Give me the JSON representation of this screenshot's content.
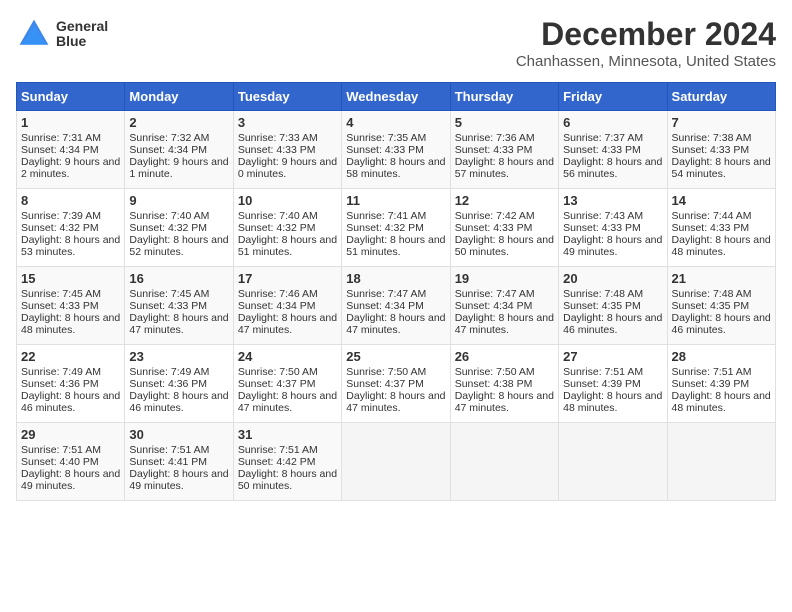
{
  "header": {
    "logo_line1": "General",
    "logo_line2": "Blue",
    "title": "December 2024",
    "subtitle": "Chanhassen, Minnesota, United States"
  },
  "columns": [
    "Sunday",
    "Monday",
    "Tuesday",
    "Wednesday",
    "Thursday",
    "Friday",
    "Saturday"
  ],
  "weeks": [
    [
      {
        "day": "1",
        "sunrise": "Sunrise: 7:31 AM",
        "sunset": "Sunset: 4:34 PM",
        "daylight": "Daylight: 9 hours and 2 minutes."
      },
      {
        "day": "2",
        "sunrise": "Sunrise: 7:32 AM",
        "sunset": "Sunset: 4:34 PM",
        "daylight": "Daylight: 9 hours and 1 minute."
      },
      {
        "day": "3",
        "sunrise": "Sunrise: 7:33 AM",
        "sunset": "Sunset: 4:33 PM",
        "daylight": "Daylight: 9 hours and 0 minutes."
      },
      {
        "day": "4",
        "sunrise": "Sunrise: 7:35 AM",
        "sunset": "Sunset: 4:33 PM",
        "daylight": "Daylight: 8 hours and 58 minutes."
      },
      {
        "day": "5",
        "sunrise": "Sunrise: 7:36 AM",
        "sunset": "Sunset: 4:33 PM",
        "daylight": "Daylight: 8 hours and 57 minutes."
      },
      {
        "day": "6",
        "sunrise": "Sunrise: 7:37 AM",
        "sunset": "Sunset: 4:33 PM",
        "daylight": "Daylight: 8 hours and 56 minutes."
      },
      {
        "day": "7",
        "sunrise": "Sunrise: 7:38 AM",
        "sunset": "Sunset: 4:33 PM",
        "daylight": "Daylight: 8 hours and 54 minutes."
      }
    ],
    [
      {
        "day": "8",
        "sunrise": "Sunrise: 7:39 AM",
        "sunset": "Sunset: 4:32 PM",
        "daylight": "Daylight: 8 hours and 53 minutes."
      },
      {
        "day": "9",
        "sunrise": "Sunrise: 7:40 AM",
        "sunset": "Sunset: 4:32 PM",
        "daylight": "Daylight: 8 hours and 52 minutes."
      },
      {
        "day": "10",
        "sunrise": "Sunrise: 7:40 AM",
        "sunset": "Sunset: 4:32 PM",
        "daylight": "Daylight: 8 hours and 51 minutes."
      },
      {
        "day": "11",
        "sunrise": "Sunrise: 7:41 AM",
        "sunset": "Sunset: 4:32 PM",
        "daylight": "Daylight: 8 hours and 51 minutes."
      },
      {
        "day": "12",
        "sunrise": "Sunrise: 7:42 AM",
        "sunset": "Sunset: 4:33 PM",
        "daylight": "Daylight: 8 hours and 50 minutes."
      },
      {
        "day": "13",
        "sunrise": "Sunrise: 7:43 AM",
        "sunset": "Sunset: 4:33 PM",
        "daylight": "Daylight: 8 hours and 49 minutes."
      },
      {
        "day": "14",
        "sunrise": "Sunrise: 7:44 AM",
        "sunset": "Sunset: 4:33 PM",
        "daylight": "Daylight: 8 hours and 48 minutes."
      }
    ],
    [
      {
        "day": "15",
        "sunrise": "Sunrise: 7:45 AM",
        "sunset": "Sunset: 4:33 PM",
        "daylight": "Daylight: 8 hours and 48 minutes."
      },
      {
        "day": "16",
        "sunrise": "Sunrise: 7:45 AM",
        "sunset": "Sunset: 4:33 PM",
        "daylight": "Daylight: 8 hours and 47 minutes."
      },
      {
        "day": "17",
        "sunrise": "Sunrise: 7:46 AM",
        "sunset": "Sunset: 4:34 PM",
        "daylight": "Daylight: 8 hours and 47 minutes."
      },
      {
        "day": "18",
        "sunrise": "Sunrise: 7:47 AM",
        "sunset": "Sunset: 4:34 PM",
        "daylight": "Daylight: 8 hours and 47 minutes."
      },
      {
        "day": "19",
        "sunrise": "Sunrise: 7:47 AM",
        "sunset": "Sunset: 4:34 PM",
        "daylight": "Daylight: 8 hours and 47 minutes."
      },
      {
        "day": "20",
        "sunrise": "Sunrise: 7:48 AM",
        "sunset": "Sunset: 4:35 PM",
        "daylight": "Daylight: 8 hours and 46 minutes."
      },
      {
        "day": "21",
        "sunrise": "Sunrise: 7:48 AM",
        "sunset": "Sunset: 4:35 PM",
        "daylight": "Daylight: 8 hours and 46 minutes."
      }
    ],
    [
      {
        "day": "22",
        "sunrise": "Sunrise: 7:49 AM",
        "sunset": "Sunset: 4:36 PM",
        "daylight": "Daylight: 8 hours and 46 minutes."
      },
      {
        "day": "23",
        "sunrise": "Sunrise: 7:49 AM",
        "sunset": "Sunset: 4:36 PM",
        "daylight": "Daylight: 8 hours and 46 minutes."
      },
      {
        "day": "24",
        "sunrise": "Sunrise: 7:50 AM",
        "sunset": "Sunset: 4:37 PM",
        "daylight": "Daylight: 8 hours and 47 minutes."
      },
      {
        "day": "25",
        "sunrise": "Sunrise: 7:50 AM",
        "sunset": "Sunset: 4:37 PM",
        "daylight": "Daylight: 8 hours and 47 minutes."
      },
      {
        "day": "26",
        "sunrise": "Sunrise: 7:50 AM",
        "sunset": "Sunset: 4:38 PM",
        "daylight": "Daylight: 8 hours and 47 minutes."
      },
      {
        "day": "27",
        "sunrise": "Sunrise: 7:51 AM",
        "sunset": "Sunset: 4:39 PM",
        "daylight": "Daylight: 8 hours and 48 minutes."
      },
      {
        "day": "28",
        "sunrise": "Sunrise: 7:51 AM",
        "sunset": "Sunset: 4:39 PM",
        "daylight": "Daylight: 8 hours and 48 minutes."
      }
    ],
    [
      {
        "day": "29",
        "sunrise": "Sunrise: 7:51 AM",
        "sunset": "Sunset: 4:40 PM",
        "daylight": "Daylight: 8 hours and 49 minutes."
      },
      {
        "day": "30",
        "sunrise": "Sunrise: 7:51 AM",
        "sunset": "Sunset: 4:41 PM",
        "daylight": "Daylight: 8 hours and 49 minutes."
      },
      {
        "day": "31",
        "sunrise": "Sunrise: 7:51 AM",
        "sunset": "Sunset: 4:42 PM",
        "daylight": "Daylight: 8 hours and 50 minutes."
      },
      null,
      null,
      null,
      null
    ]
  ]
}
